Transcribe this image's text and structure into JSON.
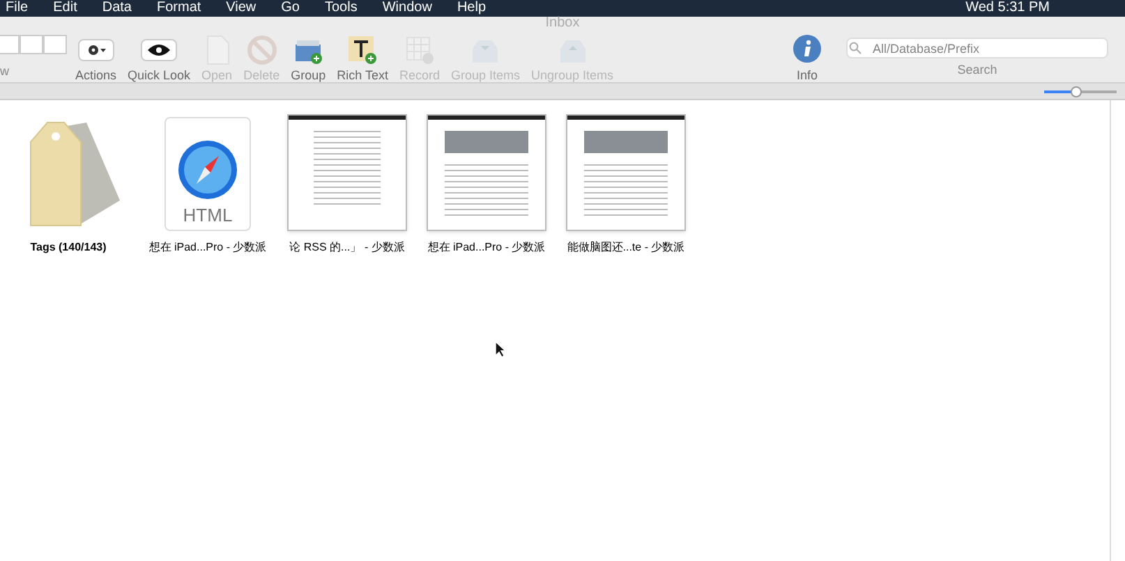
{
  "menu_bar": {
    "items": [
      "File",
      "Edit",
      "Data",
      "Format",
      "View",
      "Go",
      "Tools",
      "Window",
      "Help"
    ],
    "clock": "Wed 5:31 PM"
  },
  "window": {
    "title": "Inbox"
  },
  "toolbar": {
    "view_label": "w",
    "view_buttons": [
      {
        "selected": false
      },
      {
        "selected": false
      },
      {
        "selected": false
      }
    ],
    "tools": [
      {
        "kind": "actions",
        "label": "Actions",
        "disabled": false
      },
      {
        "kind": "quicklook",
        "label": "Quick Look",
        "disabled": false
      },
      {
        "kind": "open",
        "label": "Open",
        "disabled": true
      },
      {
        "kind": "delete",
        "label": "Delete",
        "disabled": true
      },
      {
        "kind": "group",
        "label": "Group",
        "disabled": false
      },
      {
        "kind": "richtext",
        "label": "Rich Text",
        "disabled": false
      },
      {
        "kind": "record",
        "label": "Record",
        "disabled": true
      },
      {
        "kind": "groupitems",
        "label": "Group Items",
        "disabled": true
      },
      {
        "kind": "ungroupitems",
        "label": "Ungroup Items",
        "disabled": true
      }
    ],
    "info": {
      "label": "Info"
    },
    "search": {
      "placeholder": "All/Database/Prefix",
      "label": "Search"
    }
  },
  "zoom_slider": {
    "level": 0.45
  },
  "items": [
    {
      "kind": "tags",
      "label": "Tags (140/143)"
    },
    {
      "kind": "html",
      "label": "想在 iPad...Pro - 少数派",
      "badge": "HTML"
    },
    {
      "kind": "text_page",
      "label": "论 RSS 的...」 - 少数派"
    },
    {
      "kind": "photo_page",
      "label": "想在 iPad...Pro - 少数派"
    },
    {
      "kind": "photo_page",
      "label": "能做脑图还...te - 少数派"
    }
  ]
}
